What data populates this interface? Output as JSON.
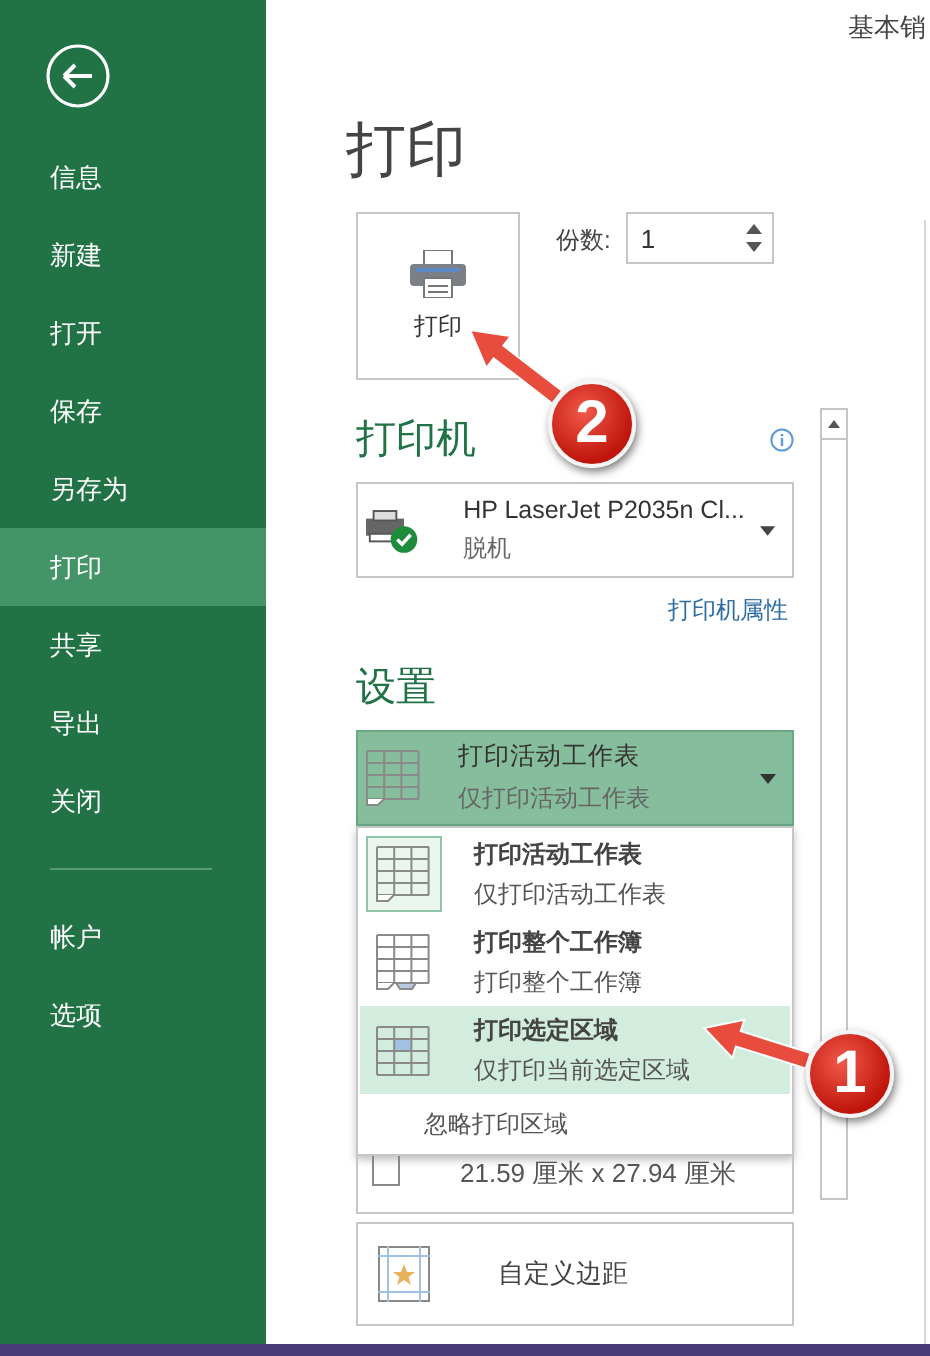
{
  "document_title": "基本销",
  "sidebar": {
    "items": [
      {
        "label": "信息",
        "selected": false
      },
      {
        "label": "新建",
        "selected": false
      },
      {
        "label": "打开",
        "selected": false
      },
      {
        "label": "保存",
        "selected": false
      },
      {
        "label": "另存为",
        "selected": false
      },
      {
        "label": "打印",
        "selected": true
      },
      {
        "label": "共享",
        "selected": false
      },
      {
        "label": "导出",
        "selected": false
      },
      {
        "label": "关闭",
        "selected": false
      }
    ],
    "bottom_items": [
      {
        "label": "帐户",
        "selected": false
      },
      {
        "label": "选项",
        "selected": false
      }
    ]
  },
  "page_title": "打印",
  "print_button": {
    "label": "打印"
  },
  "copies": {
    "label": "份数:",
    "value": "1"
  },
  "printer": {
    "heading": "打印机",
    "name": "HP LaserJet P2035n Cl...",
    "status": "脱机",
    "properties_link": "打印机属性"
  },
  "settings": {
    "heading": "设置",
    "scope": {
      "title": "打印活动工作表",
      "subtitle": "仅打印活动工作表",
      "expanded": true
    },
    "menu": {
      "items": [
        {
          "kind": "sheet",
          "title": "打印活动工作表",
          "subtitle": "仅打印活动工作表",
          "selected": true,
          "hovered": false
        },
        {
          "kind": "workbook",
          "title": "打印整个工作簿",
          "subtitle": "打印整个工作簿",
          "selected": false,
          "hovered": false
        },
        {
          "kind": "selection",
          "title": "打印选定区域",
          "subtitle": "仅打印当前选定区域",
          "selected": false,
          "hovered": true
        }
      ],
      "ignore_print_area": "忽略打印区域"
    },
    "paper": {
      "size": "21.59 厘米 x 27.94 厘米"
    },
    "margins": {
      "title": "自定义边距"
    }
  },
  "callouts": [
    {
      "number": "2"
    },
    {
      "number": "1"
    }
  ]
}
